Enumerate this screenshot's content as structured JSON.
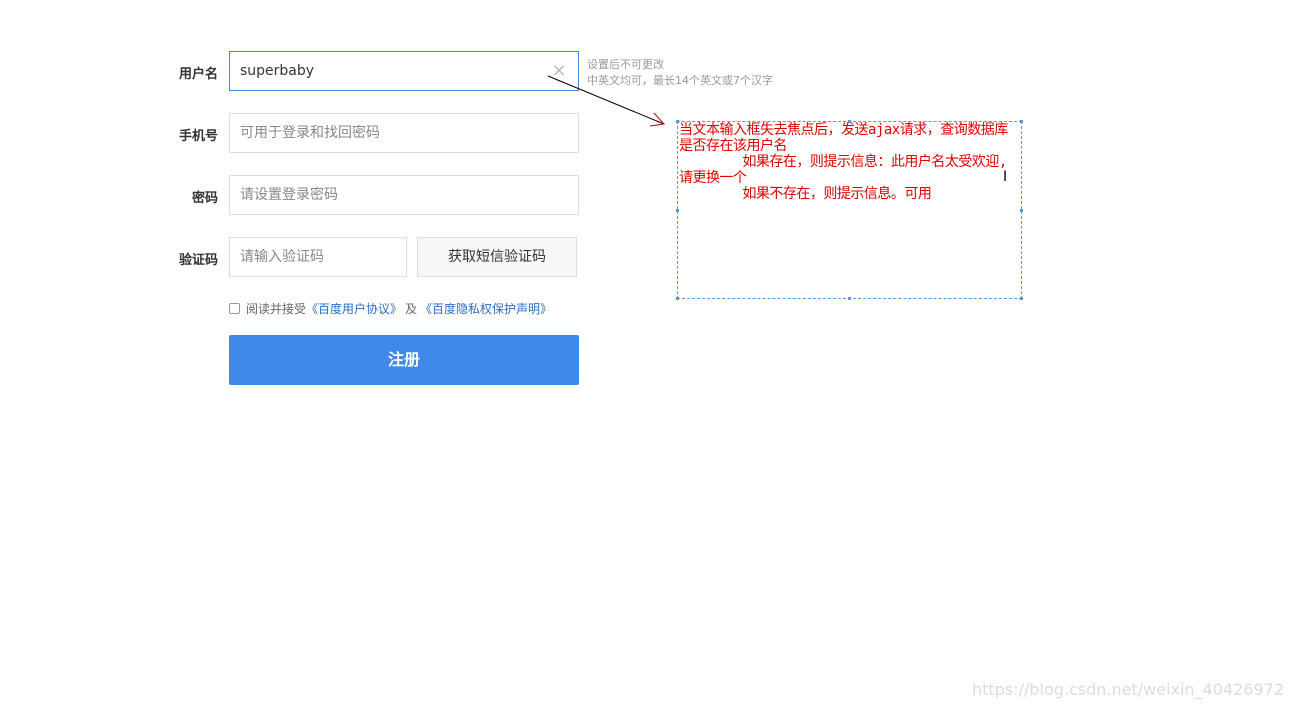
{
  "form": {
    "username": {
      "label": "用户名",
      "value": "superbaby",
      "clear_icon": "×",
      "hint_line1": "设置后不可更改",
      "hint_line2": "中英文均可，最长14个英文或7个汉字"
    },
    "phone": {
      "label": "手机号",
      "placeholder": "可用于登录和找回密码"
    },
    "password": {
      "label": "密码",
      "placeholder": "请设置登录密码"
    },
    "code": {
      "label": "验证码",
      "placeholder": "请输入验证码",
      "sms_button": "获取短信验证码"
    },
    "agreement": {
      "prefix": "阅读并接受",
      "link1": "《百度用户协议》",
      "sep": "及",
      "link2": "《百度隐私权保护声明》"
    },
    "submit_label": "注册"
  },
  "annotation": {
    "text": "当文本输入框失去焦点后，发送ajax请求，查询数据库是否存在该用户名\n        如果存在，则提示信息：此用户名太受欢迎,请更换一个\n        如果不存在，则提示信息。可用"
  },
  "watermark": "https://blog.csdn.net/weixin_40426972",
  "colors": {
    "primary": "#3f8ae8",
    "link": "#2b6cc4",
    "annotation": "#e00000",
    "focus_border": "#3f8ae0"
  }
}
